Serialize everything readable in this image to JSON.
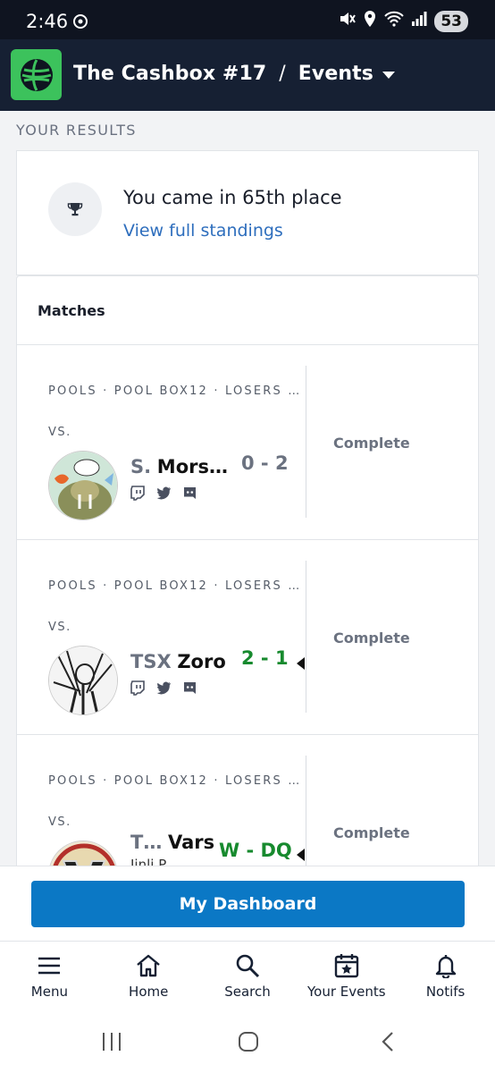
{
  "status_bar": {
    "time": "2:46",
    "battery": "53"
  },
  "header": {
    "tournament": "The Cashbox #17",
    "separator": "/",
    "section": "Events"
  },
  "results": {
    "section_label": "YOUR RESULTS",
    "place_text": "You came in 65th place",
    "standings_link": "View full standings"
  },
  "matches": {
    "title": "Matches",
    "rows": [
      {
        "phase": "POOLS · POOL BOX12 · LOSERS …",
        "vs": "VS.",
        "prefix": "S.",
        "gamertag": "Mors…",
        "score": "0 - 2",
        "status": "Complete"
      },
      {
        "phase": "POOLS · POOL BOX12 · LOSERS …",
        "vs": "VS.",
        "prefix": "TSX",
        "gamertag": "Zoro",
        "score": "2 - 1",
        "status": "Complete"
      },
      {
        "phase": "POOLS · POOL BOX12 · LOSERS …",
        "vs": "VS.",
        "prefix": "T…",
        "gamertag": "Vars",
        "subname": "Jinli P…",
        "score": "W - DQ",
        "status": "Complete"
      }
    ]
  },
  "dashboard_button": "My Dashboard",
  "bottom_nav": [
    {
      "label": "Menu",
      "icon": "menu-icon"
    },
    {
      "label": "Home",
      "icon": "home-icon"
    },
    {
      "label": "Search",
      "icon": "search-icon"
    },
    {
      "label": "Your Events",
      "icon": "calendar-star-icon"
    },
    {
      "label": "Notifs",
      "icon": "bell-icon"
    }
  ],
  "colors": {
    "header_bg": "#162033",
    "logo_green": "#3cc25c",
    "link_blue": "#2e6ebd",
    "win_green": "#178a2e",
    "button_blue": "#0b78c5"
  }
}
